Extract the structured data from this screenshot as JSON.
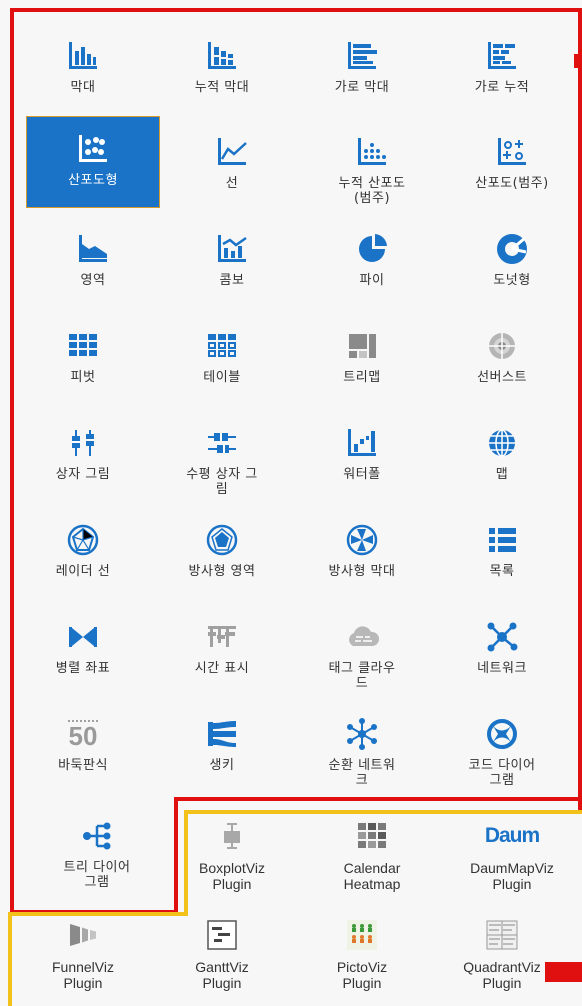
{
  "chart_types": [
    {
      "label": "막대",
      "icon": "bar-chart-icon"
    },
    {
      "label": "누적 막대",
      "icon": "stacked-bar-icon"
    },
    {
      "label": "가로 막대",
      "icon": "horizontal-bar-icon"
    },
    {
      "label": "가로 누적",
      "icon": "horizontal-stacked-icon"
    },
    {
      "label": "산포도형",
      "icon": "scatter-icon",
      "selected": true
    },
    {
      "label": "선",
      "icon": "line-icon"
    },
    {
      "label": "누적 산포도\n(범주)",
      "icon": "stacked-scatter-icon"
    },
    {
      "label": "산포도(범주)",
      "icon": "scatter-category-icon"
    },
    {
      "label": "영역",
      "icon": "area-icon"
    },
    {
      "label": "콤보",
      "icon": "combo-icon"
    },
    {
      "label": "파이",
      "icon": "pie-icon"
    },
    {
      "label": "도넛형",
      "icon": "donut-icon"
    },
    {
      "label": "피벗",
      "icon": "pivot-icon"
    },
    {
      "label": "테이블",
      "icon": "table-icon"
    },
    {
      "label": "트리맵",
      "icon": "treemap-icon"
    },
    {
      "label": "선버스트",
      "icon": "sunburst-icon"
    },
    {
      "label": "상자 그림",
      "icon": "boxplot-icon"
    },
    {
      "label": "수평 상자 그\n림",
      "icon": "horizontal-boxplot-icon"
    },
    {
      "label": "워터폴",
      "icon": "waterfall-icon"
    },
    {
      "label": "맵",
      "icon": "map-globe-icon"
    },
    {
      "label": "레이더 선",
      "icon": "radar-line-icon"
    },
    {
      "label": "방사형 영역",
      "icon": "radar-area-icon"
    },
    {
      "label": "방사형 막대",
      "icon": "radial-bar-icon"
    },
    {
      "label": "목록",
      "icon": "list-icon"
    },
    {
      "label": "병렬 좌표",
      "icon": "parallel-coordinates-icon"
    },
    {
      "label": "시간 표시",
      "icon": "timeline-icon"
    },
    {
      "label": "태그 클라우\n드",
      "icon": "tag-cloud-icon"
    },
    {
      "label": "네트워크",
      "icon": "network-icon"
    },
    {
      "label": "바둑판식",
      "icon": "tile-number-icon",
      "number": "50"
    },
    {
      "label": "생키",
      "icon": "sankey-icon"
    },
    {
      "label": "순환 네트워\n크",
      "icon": "circular-network-icon"
    },
    {
      "label": "코드 다이어\n그램",
      "icon": "chord-diagram-icon"
    },
    {
      "label": "트리 다이어\n그램",
      "icon": "tree-diagram-icon"
    }
  ],
  "plugins": [
    {
      "label": "BoxplotViz\nPlugin",
      "icon": "boxplot-plugin-icon"
    },
    {
      "label": "Calendar\nHeatmap",
      "icon": "calendar-heatmap-icon"
    },
    {
      "label": "DaumMapViz\nPlugin",
      "icon": "daum-logo-icon",
      "logo": "Daum"
    },
    {
      "label": "FunnelViz\nPlugin",
      "icon": "funnel-icon"
    },
    {
      "label": "GanttViz\nPlugin",
      "icon": "gantt-icon"
    },
    {
      "label": "PictoViz\nPlugin",
      "icon": "picto-icon"
    },
    {
      "label": "QuadrantViz\nPlugin",
      "icon": "quadrant-icon"
    }
  ],
  "colors": {
    "icon_blue": "#1a73c7",
    "icon_gray": "#9a9a9a",
    "selected_bg": "#1a73c7",
    "red_frame": "#e01010",
    "yellow_frame": "#f2c21a"
  }
}
